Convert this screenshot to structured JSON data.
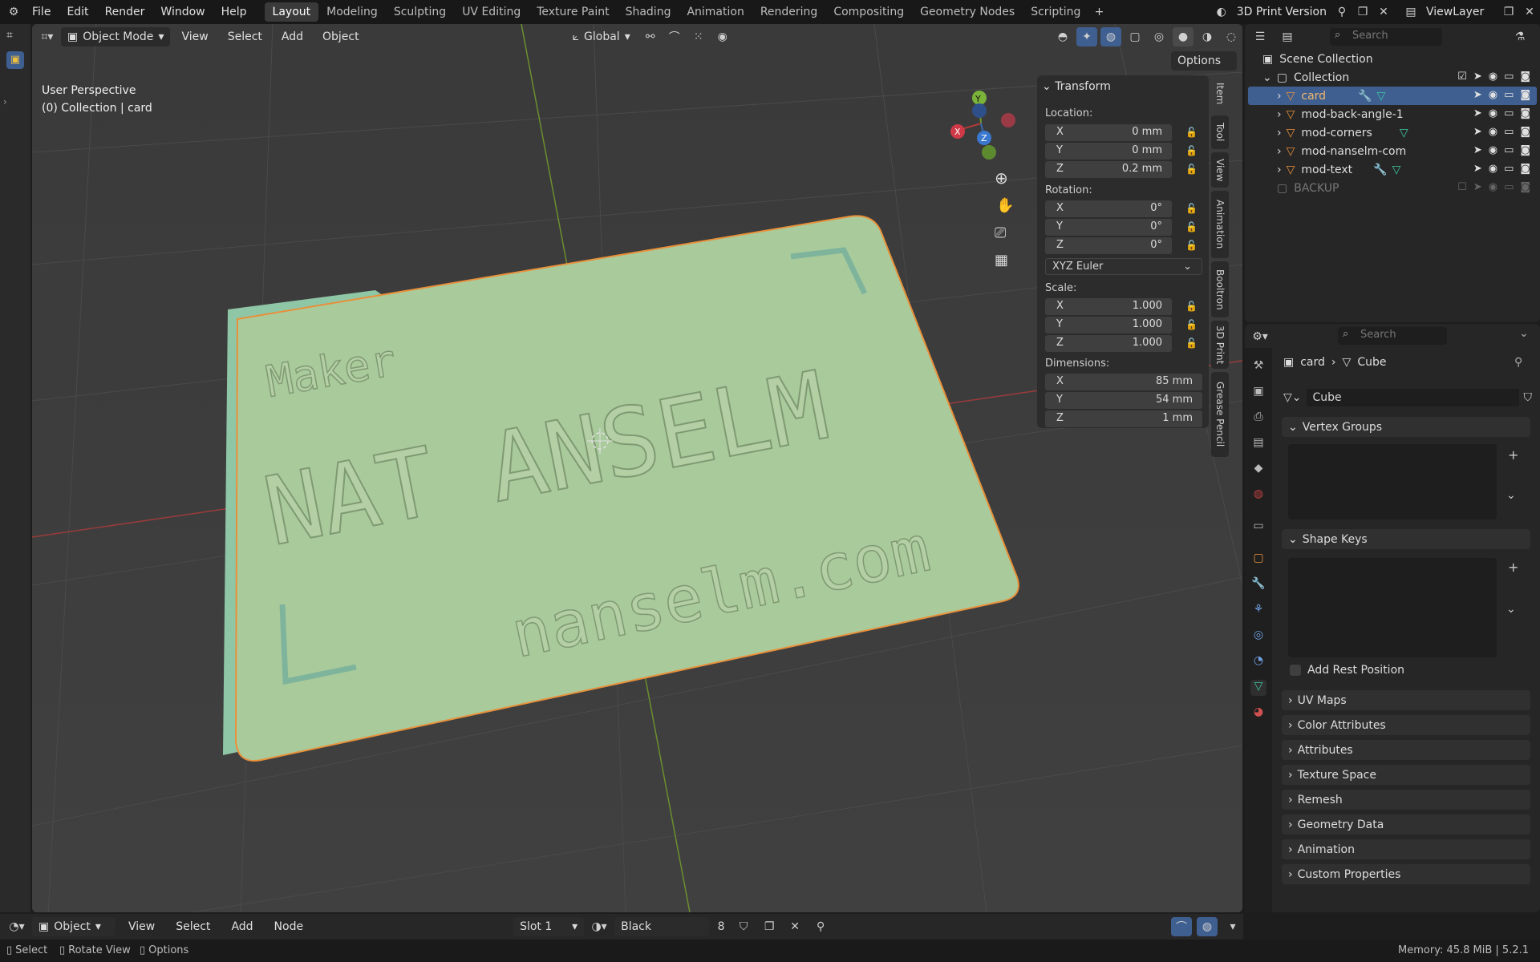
{
  "topbar": {
    "menus": [
      "File",
      "Edit",
      "Render",
      "Window",
      "Help"
    ],
    "workspaces": [
      "Layout",
      "Modeling",
      "Sculpting",
      "UV Editing",
      "Texture Paint",
      "Shading",
      "Animation",
      "Rendering",
      "Compositing",
      "Geometry Nodes",
      "Scripting"
    ],
    "active_workspace": "Layout",
    "scene_name": "3D Print Version",
    "view_layer": "ViewLayer"
  },
  "viewport": {
    "mode": "Object Mode",
    "menus": [
      "View",
      "Select",
      "Add",
      "Object"
    ],
    "transform_orientation": "Global",
    "options_label": "Options",
    "overlay_text_line1": "User Perspective",
    "overlay_text_line2": "(0) Collection | card",
    "card_text": {
      "maker": "Maker",
      "name": "NAT ANSELM",
      "url": "nanselm.com"
    },
    "gizmo": {
      "y": "Y",
      "x": "X",
      "z": "Z"
    },
    "colors": {
      "card": "#a8c9a0",
      "outline": "#e8903a",
      "background": "#3d3d3d"
    }
  },
  "npanel": {
    "section": "Transform",
    "location_label": "Location:",
    "location": [
      {
        "axis": "X",
        "value": "0 mm"
      },
      {
        "axis": "Y",
        "value": "0 mm"
      },
      {
        "axis": "Z",
        "value": "0.2 mm"
      }
    ],
    "rotation_label": "Rotation:",
    "rotation": [
      {
        "axis": "X",
        "value": "0°"
      },
      {
        "axis": "Y",
        "value": "0°"
      },
      {
        "axis": "Z",
        "value": "0°"
      }
    ],
    "rotation_mode": "XYZ Euler",
    "scale_label": "Scale:",
    "scale": [
      {
        "axis": "X",
        "value": "1.000"
      },
      {
        "axis": "Y",
        "value": "1.000"
      },
      {
        "axis": "Z",
        "value": "1.000"
      }
    ],
    "dimensions_label": "Dimensions:",
    "dimensions": [
      {
        "axis": "X",
        "value": "85 mm"
      },
      {
        "axis": "Y",
        "value": "54 mm"
      },
      {
        "axis": "Z",
        "value": "1 mm"
      }
    ],
    "tabs": [
      "Item",
      "Tool",
      "View",
      "Animation",
      "Booltron",
      "3D Print",
      "Grease Pencil"
    ]
  },
  "outliner": {
    "search_placeholder": "Search",
    "scene_collection": "Scene Collection",
    "collection": "Collection",
    "items": [
      "card",
      "mod-back-angle-1",
      "mod-corners",
      "mod-nanselm-com",
      "mod-text"
    ],
    "backup": "BACKUP"
  },
  "properties": {
    "search_placeholder": "Search",
    "breadcrumb_object": "card",
    "breadcrumb_data": "Cube",
    "mesh_name": "Cube",
    "panels_open": [
      "Vertex Groups",
      "Shape Keys"
    ],
    "add_rest_position": "Add Rest Position",
    "panels_closed": [
      "UV Maps",
      "Color Attributes",
      "Attributes",
      "Texture Space",
      "Remesh",
      "Geometry Data",
      "Animation",
      "Custom Properties"
    ]
  },
  "bottom": {
    "editor_mode": "Object",
    "menus": [
      "View",
      "Select",
      "Add",
      "Node"
    ],
    "slot": "Slot 1",
    "material": "Black",
    "users": "8"
  },
  "status": {
    "select": "Select",
    "rotate": "Rotate View",
    "options": "Options",
    "memory": "Memory: 45.8 MiB | 5.2.1"
  }
}
